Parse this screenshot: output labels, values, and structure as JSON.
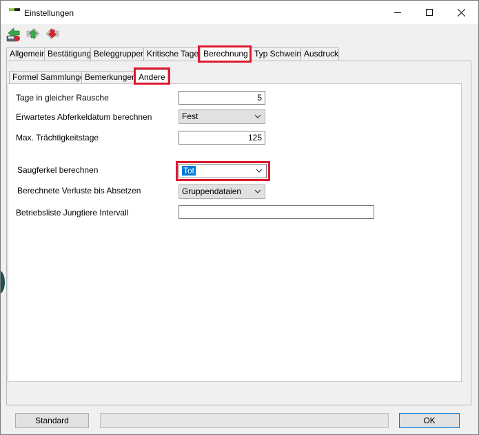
{
  "window": {
    "title": "Einstellungen"
  },
  "toolbar": {
    "icons": [
      "save-icon",
      "forward-icon",
      "back-icon"
    ]
  },
  "tabs": [
    {
      "label": "Allgemein"
    },
    {
      "label": "Bestätigung"
    },
    {
      "label": "Beleggruppen"
    },
    {
      "label": "Kritische Tage"
    },
    {
      "label": "Berechnung"
    },
    {
      "label": "Typ Schwein"
    },
    {
      "label": "Ausdruck"
    }
  ],
  "subtabs": [
    {
      "label": "Formel Sammlungen"
    },
    {
      "label": "Bemerkungen"
    },
    {
      "label": "Andere"
    }
  ],
  "form": {
    "tage_rausche": {
      "label": "Tage in gleicher Rausche",
      "value": "5"
    },
    "abferkeldatum": {
      "label": "Erwartetes Abferkeldatum berechnen",
      "value": "Fest"
    },
    "traechtigkeit": {
      "label": "Max. Trächtigkeitstage",
      "value": "125"
    },
    "saugferkel": {
      "label": "Saugferkel berechnen",
      "value": "Tot"
    },
    "verluste": {
      "label": "Berechnete Verluste bis Absetzen",
      "value": "Gruppendataien"
    },
    "betriebsliste": {
      "label": "Betriebsliste Jungtiere Intervall",
      "value": ""
    }
  },
  "footer": {
    "standard_label": "Standard",
    "ok_label": "OK"
  },
  "colors": {
    "highlight": "#e0182f",
    "selection": "#0078d7"
  }
}
